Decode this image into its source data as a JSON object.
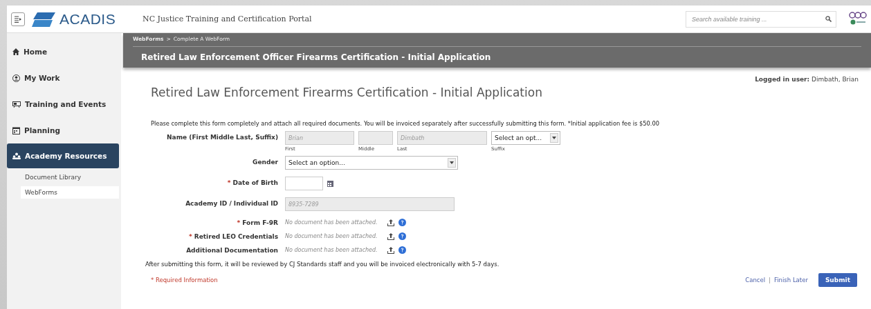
{
  "header": {
    "portal_title": "NC Justice Training and Certification Portal",
    "logo_text": "ACADIS",
    "search": {
      "placeholder": "Search available training ..."
    }
  },
  "sidebar": {
    "items": [
      {
        "label": "Home",
        "selected": false
      },
      {
        "label": "My Work",
        "selected": false
      },
      {
        "label": "Training and Events",
        "selected": false
      },
      {
        "label": "Planning",
        "selected": false
      },
      {
        "label": "Academy Resources",
        "selected": true,
        "children": [
          {
            "label": "Document Library",
            "selected": false
          },
          {
            "label": "WebForms",
            "selected": true
          }
        ]
      }
    ]
  },
  "banner": {
    "breadcrumb": [
      {
        "label": "WebForms",
        "current": false
      },
      {
        "label": "Complete A WebForm",
        "current": true
      }
    ],
    "breadcrumb_separator": ">",
    "title": "Retired Law Enforcement Officer Firearms Certification - Initial Application"
  },
  "logged_in": {
    "label": "Logged in user:",
    "user": "Dimbath, Brian"
  },
  "form": {
    "title": "Retired Law Enforcement Firearms Certification - Initial Application",
    "intro": "Please complete this form completely and attach all required documents. You will be invoiced separately after successfully submitting this form. *Initial application fee is $50.00",
    "required_marker": "*",
    "rows": [
      {
        "kind": "name",
        "label": "Name (First Middle Last, Suffix)",
        "required": false,
        "parts": [
          {
            "kind": "text",
            "caption": "First",
            "value": "Brian",
            "disabled": true
          },
          {
            "kind": "text",
            "caption": "Middle",
            "disabled": true
          },
          {
            "kind": "text",
            "caption": "Last",
            "value": "Dimbath",
            "disabled": true
          },
          {
            "kind": "select",
            "caption": "Suffix",
            "value": "Select an opt..."
          }
        ]
      },
      {
        "kind": "select",
        "label": "Gender",
        "required": false,
        "value": "Select an option..."
      },
      {
        "kind": "date",
        "label": "Date of Birth",
        "required": true
      },
      {
        "kind": "text",
        "label": "Academy ID / Individual ID",
        "required": false,
        "value": "8935-7289",
        "disabled": true
      },
      {
        "kind": "file",
        "label": "Form F-9R",
        "required": true,
        "status": "No document has been attached."
      },
      {
        "kind": "file",
        "label": "Retired LEO Credentials",
        "required": true,
        "status": "No document has been attached."
      },
      {
        "kind": "file",
        "label": "Additional Documentation",
        "required": false,
        "status": "No document has been attached."
      }
    ],
    "note": "After submitting this form, it will be reviewed by CJ Standards staff and you will be invoiced electronically with 5-7 days.",
    "required_note": "* Required Information",
    "actions": {
      "cancel": "Cancel",
      "separator": "|",
      "finish_later": "Finish Later",
      "submit": "Submit"
    }
  }
}
